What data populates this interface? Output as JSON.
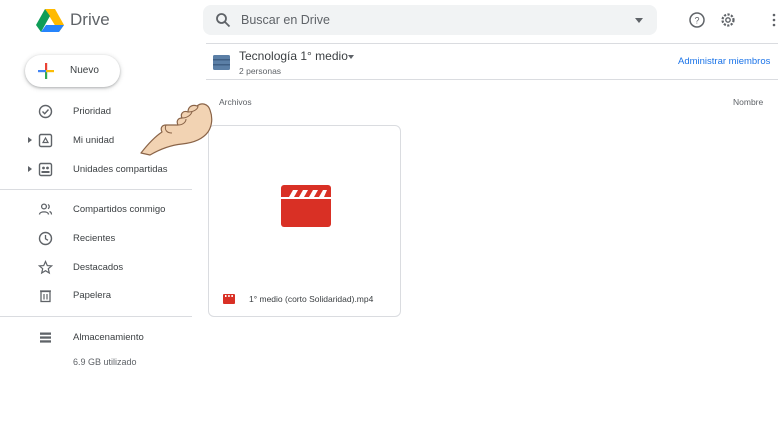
{
  "header": {
    "app_name": "Drive",
    "search_placeholder": "Buscar en Drive"
  },
  "sidebar": {
    "new_button": "Nuevo",
    "items": [
      {
        "label": "Prioridad",
        "icon": "check-circle-icon"
      },
      {
        "label": "Mi unidad",
        "icon": "my-drive-icon"
      },
      {
        "label": "Unidades compartidas",
        "icon": "shared-drives-icon"
      },
      {
        "label": "Compartidos conmigo",
        "icon": "shared-with-me-icon"
      },
      {
        "label": "Recientes",
        "icon": "clock-icon"
      },
      {
        "label": "Destacados",
        "icon": "star-icon"
      },
      {
        "label": "Papelera",
        "icon": "trash-icon"
      },
      {
        "label": "Almacenamiento",
        "icon": "storage-icon"
      }
    ],
    "storage_used": "6.9 GB utilizado"
  },
  "main": {
    "folder_title": "Tecnología 1° medio",
    "folder_members": "2 personas",
    "admin_link": "Administrar miembros",
    "section_title": "Archivos",
    "sort_label": "Nombre",
    "files": [
      {
        "name": "1° medio (corto Solidaridad).mp4",
        "type": "video"
      }
    ]
  },
  "colors": {
    "accent": "#1a73e8",
    "video_red": "#d93025"
  }
}
